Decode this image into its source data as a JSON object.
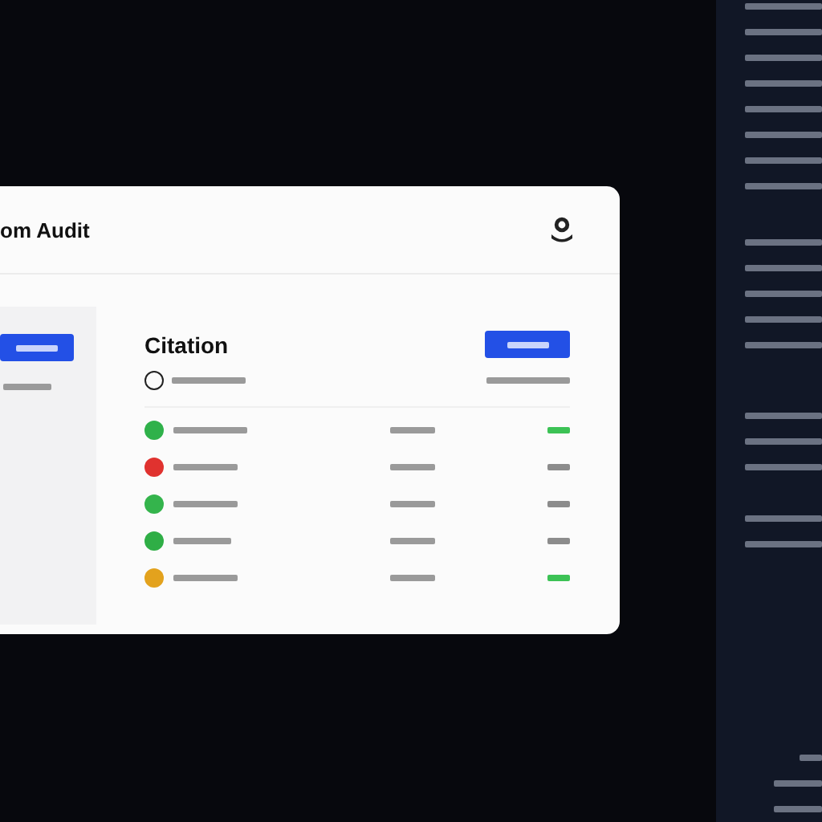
{
  "window": {
    "title": "om Audit"
  },
  "main": {
    "heading": "Citation",
    "radio": {
      "selected": false
    }
  },
  "rows": [
    {
      "color": "#2fb14a",
      "value_positive": true
    },
    {
      "color": "#e0322f",
      "value_positive": false
    },
    {
      "color": "#34b44c",
      "value_positive": false
    },
    {
      "color": "#2fae46",
      "value_positive": false
    },
    {
      "color": "#e3a21d",
      "value_positive": true
    }
  ]
}
